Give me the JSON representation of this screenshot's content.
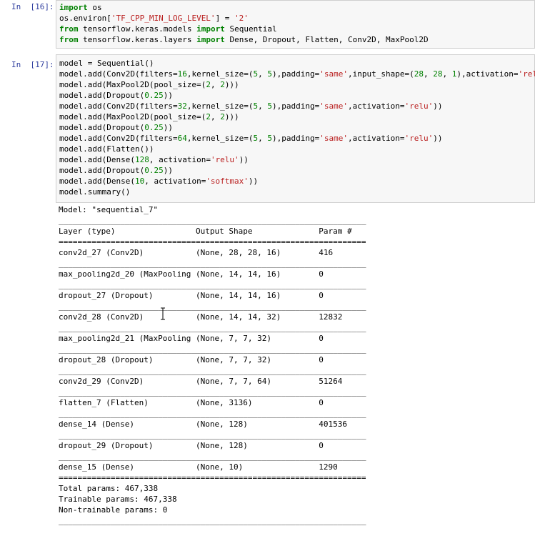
{
  "cell16": {
    "prompt": "In  [16]:",
    "lines": [
      [
        {
          "t": "import",
          "c": "kw"
        },
        {
          "t": " os",
          "c": ""
        }
      ],
      [
        {
          "t": "os.environ[",
          "c": ""
        },
        {
          "t": "'TF_CPP_MIN_LOG_LEVEL'",
          "c": "str"
        },
        {
          "t": "] = ",
          "c": ""
        },
        {
          "t": "'2'",
          "c": "str"
        }
      ],
      [
        {
          "t": "from",
          "c": "kw"
        },
        {
          "t": " tensorflow.keras.models ",
          "c": ""
        },
        {
          "t": "import",
          "c": "kw"
        },
        {
          "t": " Sequential",
          "c": ""
        }
      ],
      [
        {
          "t": "from",
          "c": "kw"
        },
        {
          "t": " tensorflow.keras.layers ",
          "c": ""
        },
        {
          "t": "import",
          "c": "kw"
        },
        {
          "t": " Dense, Dropout, Flatten, Conv2D, MaxPool2D",
          "c": ""
        }
      ]
    ]
  },
  "cell17": {
    "prompt": "In  [17]:",
    "lines": [
      [
        {
          "t": "model = Sequential()",
          "c": ""
        }
      ],
      [
        {
          "t": "model.add(Conv2D(filters=",
          "c": ""
        },
        {
          "t": "16",
          "c": "num"
        },
        {
          "t": ",kernel_size=(",
          "c": ""
        },
        {
          "t": "5",
          "c": "num"
        },
        {
          "t": ", ",
          "c": ""
        },
        {
          "t": "5",
          "c": "num"
        },
        {
          "t": "),padding=",
          "c": ""
        },
        {
          "t": "'same'",
          "c": "str"
        },
        {
          "t": ",input_shape=(",
          "c": ""
        },
        {
          "t": "28",
          "c": "num"
        },
        {
          "t": ", ",
          "c": ""
        },
        {
          "t": "28",
          "c": "num"
        },
        {
          "t": ", ",
          "c": ""
        },
        {
          "t": "1",
          "c": "num"
        },
        {
          "t": "),activation=",
          "c": ""
        },
        {
          "t": "'relu'",
          "c": "str"
        },
        {
          "t": "))",
          "c": ""
        }
      ],
      [
        {
          "t": "model.add(MaxPool2D(pool_size=(",
          "c": ""
        },
        {
          "t": "2",
          "c": "num"
        },
        {
          "t": ", ",
          "c": ""
        },
        {
          "t": "2",
          "c": "num"
        },
        {
          "t": ")))",
          "c": ""
        }
      ],
      [
        {
          "t": "model.add(Dropout(",
          "c": ""
        },
        {
          "t": "0.25",
          "c": "num"
        },
        {
          "t": "))",
          "c": ""
        }
      ],
      [
        {
          "t": "model.add(Conv2D(filters=",
          "c": ""
        },
        {
          "t": "32",
          "c": "num"
        },
        {
          "t": ",kernel_size=(",
          "c": ""
        },
        {
          "t": "5",
          "c": "num"
        },
        {
          "t": ", ",
          "c": ""
        },
        {
          "t": "5",
          "c": "num"
        },
        {
          "t": "),padding=",
          "c": ""
        },
        {
          "t": "'same'",
          "c": "str"
        },
        {
          "t": ",activation=",
          "c": ""
        },
        {
          "t": "'relu'",
          "c": "str"
        },
        {
          "t": "))",
          "c": ""
        }
      ],
      [
        {
          "t": "model.add(MaxPool2D(pool_size=(",
          "c": ""
        },
        {
          "t": "2",
          "c": "num"
        },
        {
          "t": ", ",
          "c": ""
        },
        {
          "t": "2",
          "c": "num"
        },
        {
          "t": ")))",
          "c": ""
        }
      ],
      [
        {
          "t": "model.add(Dropout(",
          "c": ""
        },
        {
          "t": "0.25",
          "c": "num"
        },
        {
          "t": "))",
          "c": ""
        }
      ],
      [
        {
          "t": "model.add(Conv2D(filters=",
          "c": ""
        },
        {
          "t": "64",
          "c": "num"
        },
        {
          "t": ",kernel_size=(",
          "c": ""
        },
        {
          "t": "5",
          "c": "num"
        },
        {
          "t": ", ",
          "c": ""
        },
        {
          "t": "5",
          "c": "num"
        },
        {
          "t": "),padding=",
          "c": ""
        },
        {
          "t": "'same'",
          "c": "str"
        },
        {
          "t": ",activation=",
          "c": ""
        },
        {
          "t": "'relu'",
          "c": "str"
        },
        {
          "t": "))",
          "c": ""
        }
      ],
      [
        {
          "t": "model.add(Flatten())",
          "c": ""
        }
      ],
      [
        {
          "t": "model.add(Dense(",
          "c": ""
        },
        {
          "t": "128",
          "c": "num"
        },
        {
          "t": ", activation=",
          "c": ""
        },
        {
          "t": "'relu'",
          "c": "str"
        },
        {
          "t": "))",
          "c": ""
        }
      ],
      [
        {
          "t": "model.add(Dropout(",
          "c": ""
        },
        {
          "t": "0.25",
          "c": "num"
        },
        {
          "t": "))",
          "c": ""
        }
      ],
      [
        {
          "t": "model.add(Dense(",
          "c": ""
        },
        {
          "t": "10",
          "c": "num"
        },
        {
          "t": ", activation=",
          "c": ""
        },
        {
          "t": "'softmax'",
          "c": "str"
        },
        {
          "t": "))",
          "c": ""
        }
      ],
      [
        {
          "t": "model.summary()",
          "c": ""
        }
      ]
    ],
    "output": [
      "Model: \"sequential_7\"",
      "_________________________________________________________________",
      "Layer (type)                 Output Shape              Param #   ",
      "=================================================================",
      "conv2d_27 (Conv2D)           (None, 28, 28, 16)        416       ",
      "_________________________________________________________________",
      "max_pooling2d_20 (MaxPooling (None, 14, 14, 16)        0         ",
      "_________________________________________________________________",
      "dropout_27 (Dropout)         (None, 14, 14, 16)        0         ",
      "_________________________________________________________________",
      "conv2d_28 (Conv2D)           (None, 14, 14, 32)        12832     ",
      "_________________________________________________________________",
      "max_pooling2d_21 (MaxPooling (None, 7, 7, 32)          0         ",
      "_________________________________________________________________",
      "dropout_28 (Dropout)         (None, 7, 7, 32)          0         ",
      "_________________________________________________________________",
      "conv2d_29 (Conv2D)           (None, 7, 7, 64)          51264     ",
      "_________________________________________________________________",
      "flatten_7 (Flatten)          (None, 3136)              0         ",
      "_________________________________________________________________",
      "dense_14 (Dense)             (None, 128)               401536    ",
      "_________________________________________________________________",
      "dropout_29 (Dropout)         (None, 128)               0         ",
      "_________________________________________________________________",
      "dense_15 (Dense)             (None, 10)                1290      ",
      "=================================================================",
      "Total params: 467,338",
      "Trainable params: 467,338",
      "Non-trainable params: 0",
      "_________________________________________________________________"
    ]
  },
  "colors": {
    "prompt": "#303f9f",
    "keyword": "#008000",
    "string": "#ba2121",
    "number": "#008000",
    "code_bg": "#f7f7f7",
    "code_border": "#cfcfcf"
  },
  "icons": {
    "cursor": "text-cursor-icon"
  }
}
